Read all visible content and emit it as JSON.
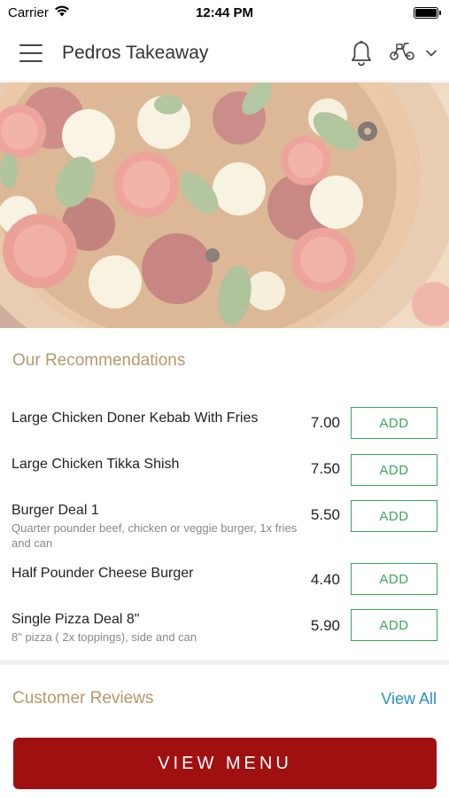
{
  "status_bar": {
    "carrier": "Carrier",
    "time": "12:44 PM"
  },
  "header": {
    "title": "Pedros Takeaway",
    "icons": [
      "menu-icon",
      "bell-icon",
      "scooter-icon",
      "chevron-down-icon"
    ]
  },
  "recommendations": {
    "title": "Our Recommendations",
    "items": [
      {
        "name": "Large Chicken Doner Kebab With Fries",
        "description": "",
        "price": "7.00",
        "add_label": "ADD"
      },
      {
        "name": "Large Chicken Tikka Shish",
        "description": "",
        "price": "7.50",
        "add_label": "ADD"
      },
      {
        "name": "Burger Deal 1",
        "description": "Quarter pounder beef, chicken or veggie burger, 1x fries and can",
        "price": "5.50",
        "add_label": "ADD"
      },
      {
        "name": "Half Pounder Cheese Burger",
        "description": "",
        "price": "4.40",
        "add_label": "ADD"
      },
      {
        "name": "Single Pizza Deal 8\"",
        "description": "8\" pizza ( 2x toppings),  side and can",
        "price": "5.90",
        "add_label": "ADD"
      }
    ]
  },
  "reviews": {
    "title": "Customer Reviews",
    "view_all_label": "View All"
  },
  "footer": {
    "view_menu_label": "VIEW MENU"
  },
  "colors": {
    "accent_gold": "#b39a6c",
    "add_green": "#3aa757",
    "link_blue": "#2a8fc4",
    "primary_red": "#a01010"
  }
}
